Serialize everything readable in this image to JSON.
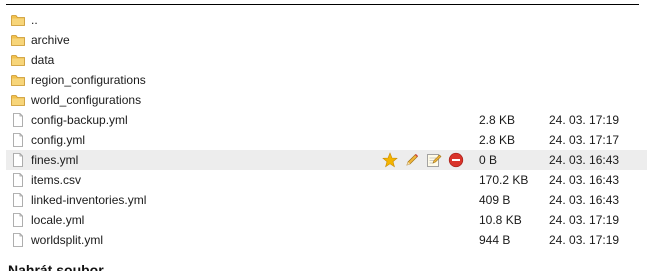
{
  "rows": [
    {
      "type": "folder",
      "name": "..",
      "size": "",
      "date": ""
    },
    {
      "type": "folder",
      "name": "archive",
      "size": "",
      "date": ""
    },
    {
      "type": "folder",
      "name": "data",
      "size": "",
      "date": ""
    },
    {
      "type": "folder",
      "name": "region_configurations",
      "size": "",
      "date": ""
    },
    {
      "type": "folder",
      "name": "world_configurations",
      "size": "",
      "date": ""
    },
    {
      "type": "file",
      "name": "config-backup.yml",
      "size": "2.8 KB",
      "date": "24. 03. 17:19"
    },
    {
      "type": "file",
      "name": "config.yml",
      "size": "2.8 KB",
      "date": "24. 03. 17:17"
    },
    {
      "type": "file",
      "name": "fines.yml",
      "size": "0 B",
      "date": "24. 03. 16:43",
      "highlighted": true
    },
    {
      "type": "file",
      "name": "items.csv",
      "size": "170.2 KB",
      "date": "24. 03. 16:43"
    },
    {
      "type": "file",
      "name": "linked-inventories.yml",
      "size": "409 B",
      "date": "24. 03. 16:43"
    },
    {
      "type": "file",
      "name": "locale.yml",
      "size": "10.8 KB",
      "date": "24. 03. 17:19"
    },
    {
      "type": "file",
      "name": "worldsplit.yml",
      "size": "944 B",
      "date": "24. 03. 17:19"
    }
  ],
  "row_actions": [
    "star-icon",
    "pencil-icon",
    "edit-icon",
    "delete-icon"
  ],
  "footer": {
    "text": "Nahrát soubor"
  },
  "colors": {
    "folder": "#f2c14e",
    "highlight": "#ededed",
    "delete": "#d9342b",
    "star": "#f4b400"
  }
}
